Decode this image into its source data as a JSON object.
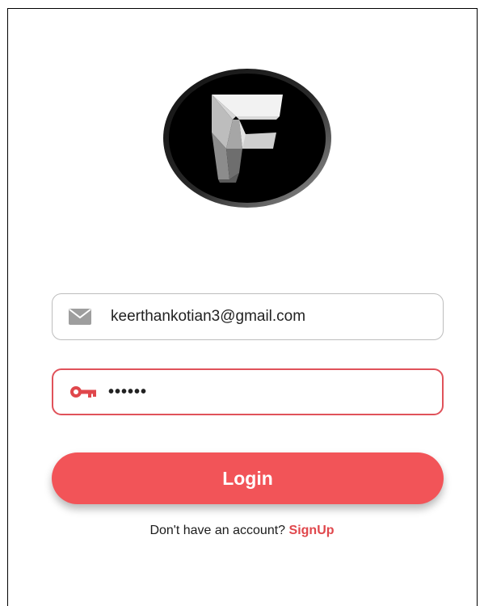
{
  "logo": {
    "icon": "letter-f-logo-icon",
    "letter": "F"
  },
  "email_field": {
    "icon": "mail-icon",
    "value": "keerthankotian3@gmail.com",
    "icon_color": "#9e9e9e",
    "border_color": "#bdbdbd"
  },
  "password_field": {
    "icon": "key-icon",
    "value": "••••••",
    "icon_color": "#e0474c",
    "border_color": "#e0525a"
  },
  "login_button": {
    "label": "Login",
    "color": "#f25458"
  },
  "signup": {
    "prompt": "Don't have an account?",
    "link_label": "SignUp",
    "link_color": "#e0474c"
  }
}
